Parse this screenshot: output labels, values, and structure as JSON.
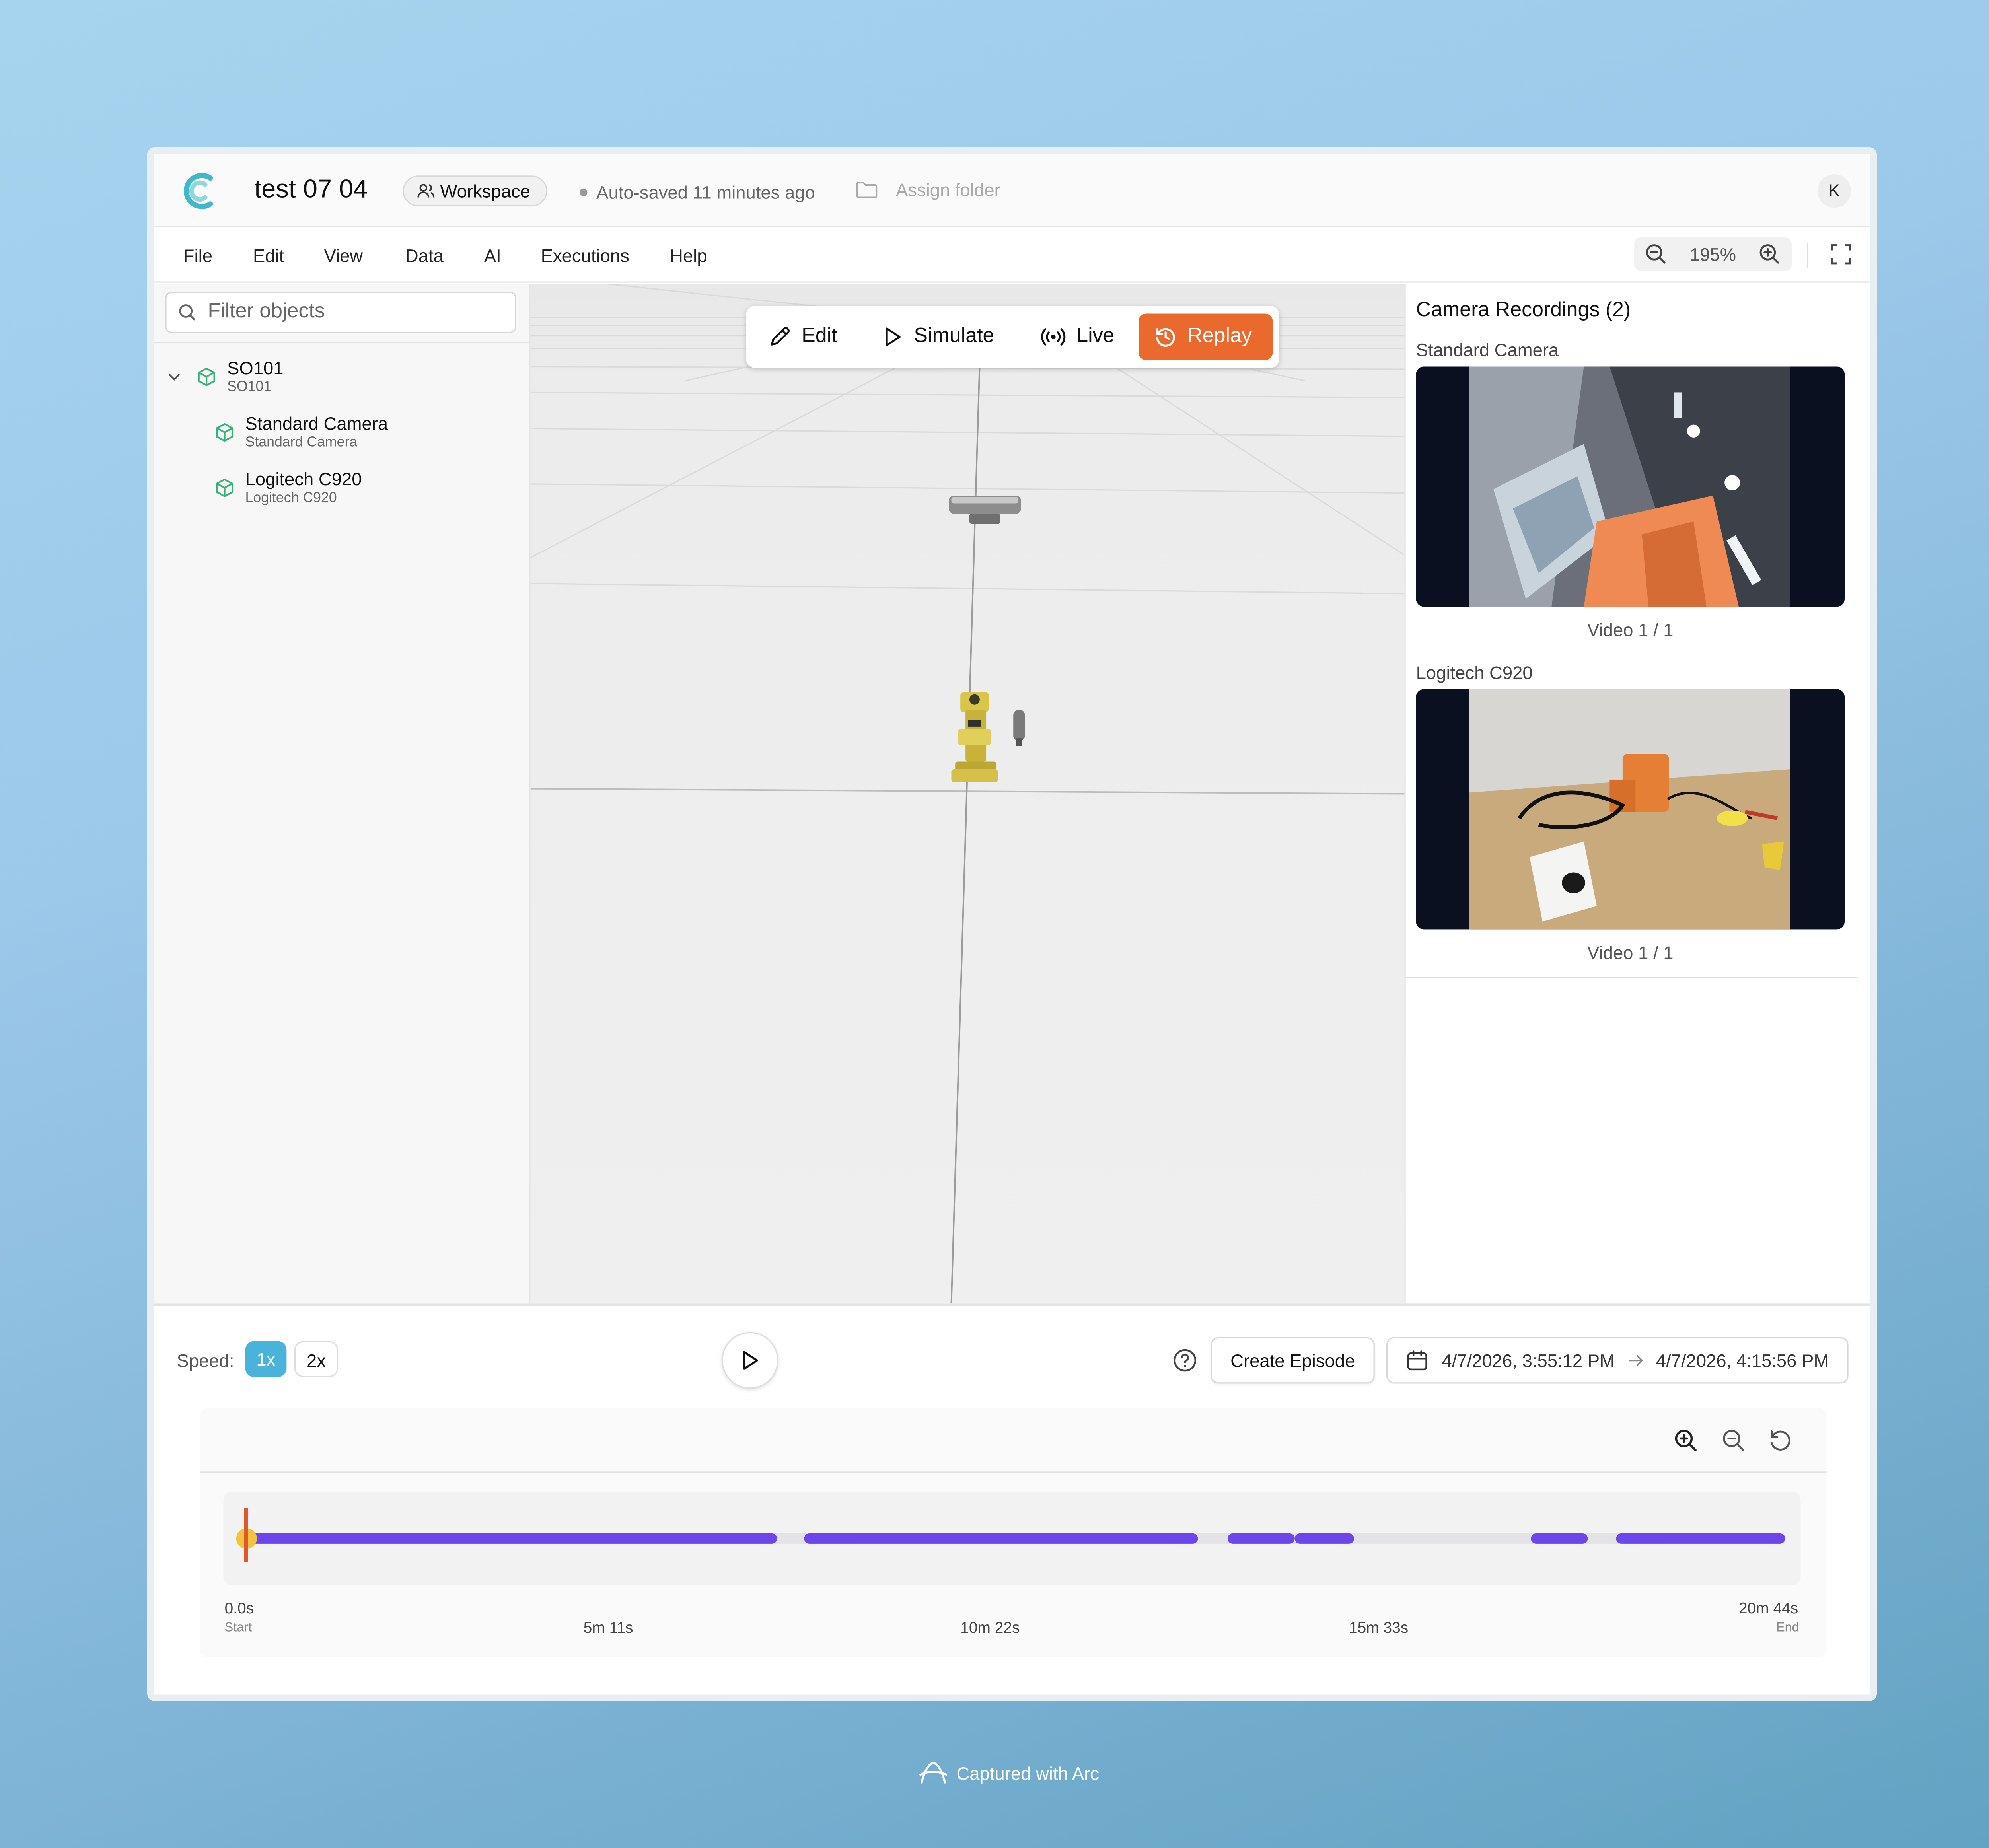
{
  "app": {
    "title": "test 07 04",
    "workspace_label": "Workspace",
    "autosave": "Auto-saved 11 minutes ago",
    "assign_folder": "Assign folder",
    "avatar_initial": "K",
    "accent": "#ea6a2e",
    "brand": "#3fb9c9"
  },
  "menu": [
    "File",
    "Edit",
    "View",
    "Data",
    "AI",
    "Executions",
    "Help"
  ],
  "zoom": {
    "value": "195%"
  },
  "sidebar": {
    "filter_placeholder": "Filter objects",
    "items": [
      {
        "name": "SO101",
        "sub": "SO101"
      },
      {
        "name": "Standard Camera",
        "sub": "Standard Camera"
      },
      {
        "name": "Logitech C920",
        "sub": "Logitech C920"
      }
    ]
  },
  "modes": [
    {
      "label": "Edit",
      "icon": "pencil-icon"
    },
    {
      "label": "Simulate",
      "icon": "play-icon"
    },
    {
      "label": "Live",
      "icon": "broadcast-icon"
    },
    {
      "label": "Replay",
      "icon": "history-icon",
      "active": true
    }
  ],
  "recordings": {
    "title": "Camera Recordings (2)",
    "cams": [
      {
        "name": "Standard Camera",
        "caption": "Video 1 / 1"
      },
      {
        "name": "Logitech C920",
        "caption": "Video 1 / 1"
      }
    ]
  },
  "player": {
    "speed_label": "Speed:",
    "speeds": [
      "1x",
      "2x"
    ],
    "active_speed": "1x",
    "create_episode": "Create Episode",
    "date_start": "4/7/2026, 3:55:12 PM",
    "date_end": "4/7/2026, 4:15:56 PM",
    "playhead_fraction": 0.0
  },
  "timeline": {
    "ticks": [
      {
        "label": "0.0s",
        "sub": "Start"
      },
      {
        "label": "5m 11s",
        "sub": ""
      },
      {
        "label": "10m 22s",
        "sub": ""
      },
      {
        "label": "15m 33s",
        "sub": ""
      },
      {
        "label": "20m 44s",
        "sub": "End"
      }
    ],
    "segments": [
      [
        0.0,
        0.345
      ],
      [
        0.362,
        0.618
      ],
      [
        0.638,
        0.681
      ],
      [
        0.681,
        0.72
      ],
      [
        0.835,
        0.872
      ],
      [
        0.89,
        1.0
      ]
    ]
  },
  "footer": {
    "captured": "Captured with Arc"
  }
}
